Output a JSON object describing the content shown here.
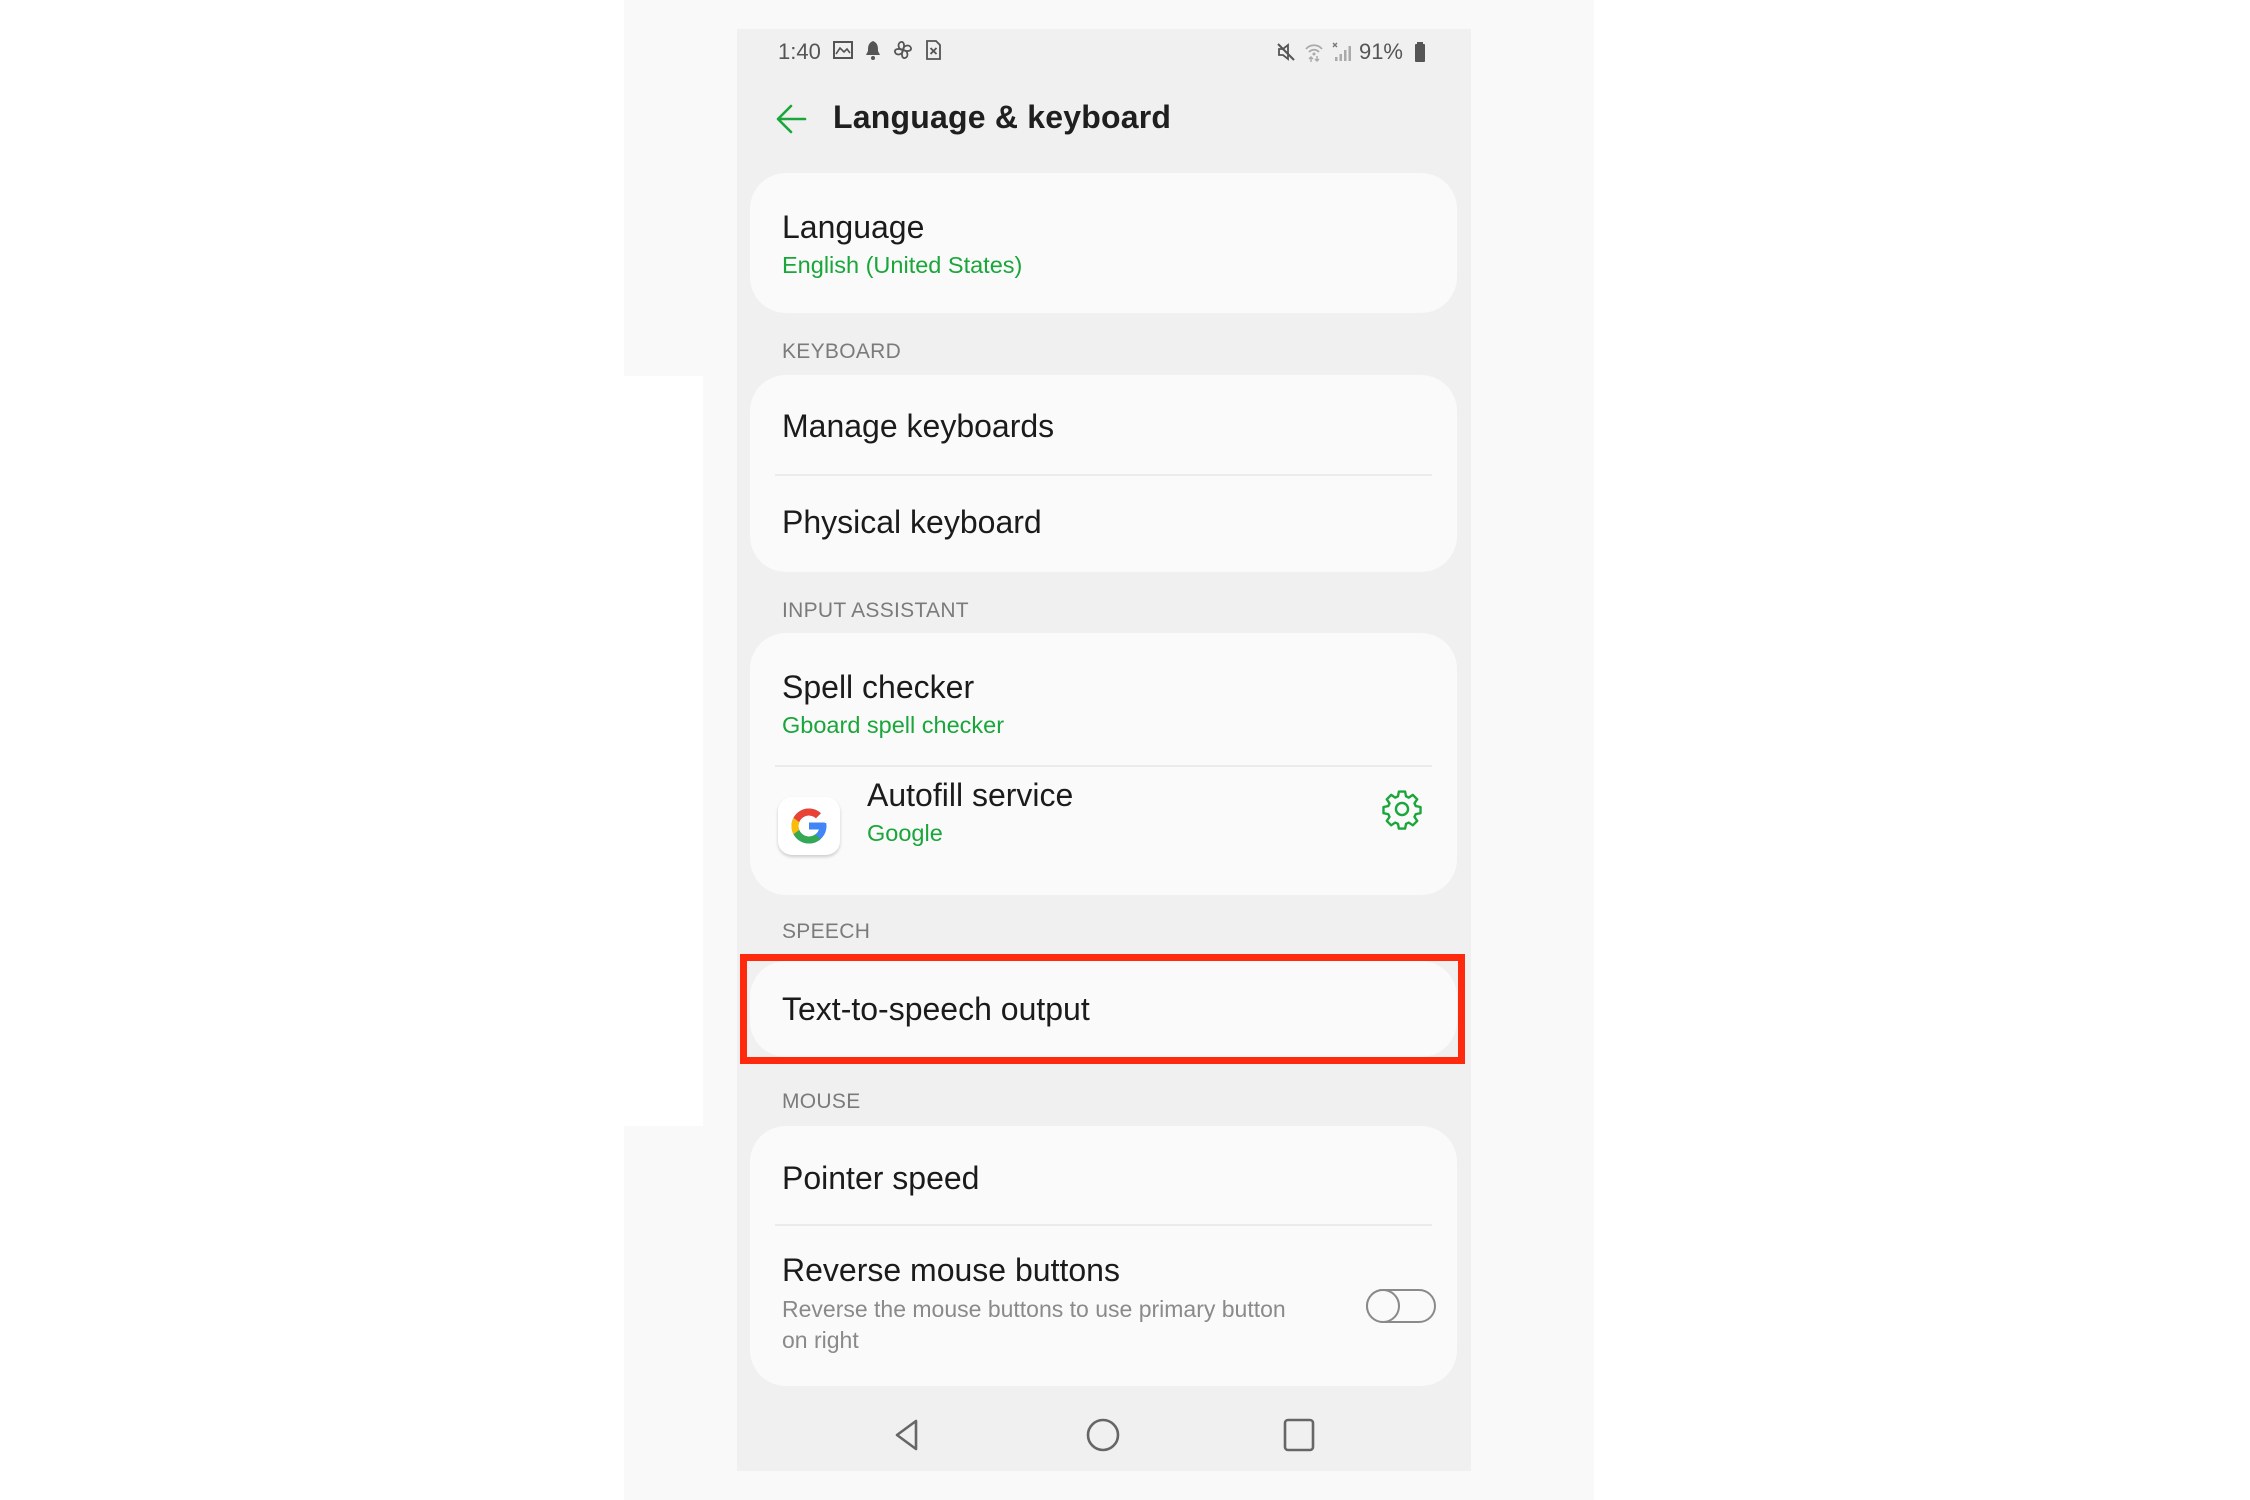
{
  "status_bar": {
    "time": "1:40",
    "left_icons": [
      "gallery-icon",
      "bell-icon",
      "pinwheel-icon",
      "sim-x-icon"
    ],
    "right_icons": [
      "mute-icon",
      "wifi-icon",
      "signal-icon"
    ],
    "battery_text": "91%",
    "battery_level": 0.91
  },
  "header": {
    "title": "Language & keyboard",
    "back_icon": "arrow-left-icon"
  },
  "colors": {
    "accent": "#1aa63a",
    "highlight": "#ff2a0e",
    "background": "#f0f0f0",
    "card": "#fafafa"
  },
  "language_card": {
    "title": "Language",
    "subtitle": "English (United States)"
  },
  "sections": {
    "keyboard": {
      "header": "KEYBOARD",
      "items": [
        {
          "title": "Manage keyboards"
        },
        {
          "title": "Physical keyboard"
        }
      ]
    },
    "input_assistant": {
      "header": "INPUT ASSISTANT",
      "items": [
        {
          "title": "Spell checker",
          "subtitle": "Gboard spell checker"
        },
        {
          "title": "Autofill service",
          "subtitle": "Google",
          "icon": "google-g-icon",
          "action_icon": "gear-icon"
        }
      ]
    },
    "speech": {
      "header": "SPEECH",
      "items": [
        {
          "title": "Text-to-speech output",
          "highlighted": true
        }
      ]
    },
    "mouse": {
      "header": "MOUSE",
      "items": [
        {
          "title": "Pointer speed"
        },
        {
          "title": "Reverse mouse buttons",
          "description": "Reverse the mouse buttons to use primary button on right",
          "toggle": false
        }
      ]
    }
  },
  "nav_bar": {
    "buttons": [
      "back-triangle-icon",
      "home-circle-icon",
      "recents-square-icon"
    ]
  }
}
